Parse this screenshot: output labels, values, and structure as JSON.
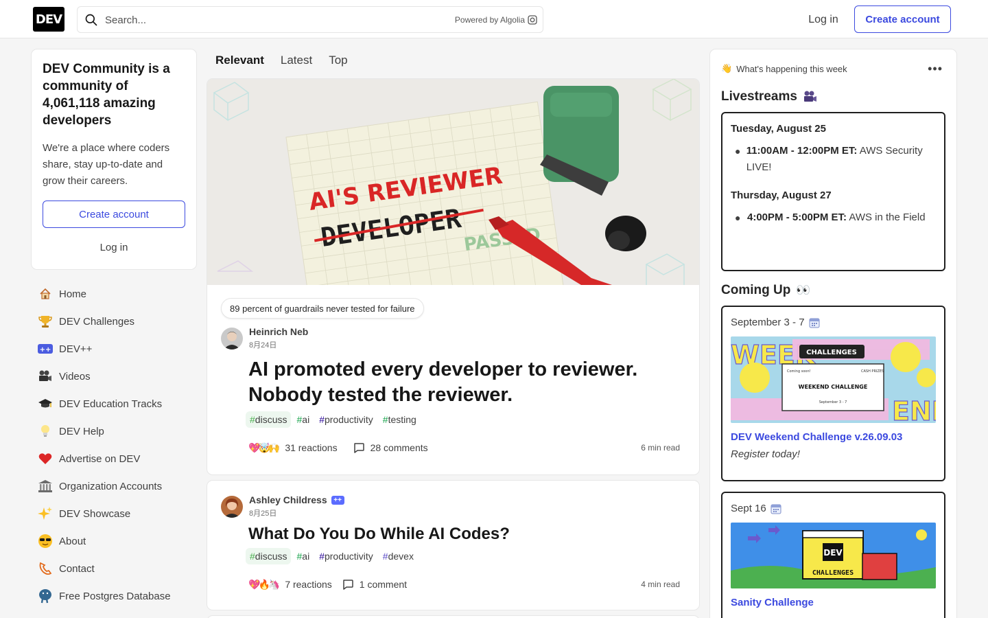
{
  "header": {
    "logo": "DEV",
    "search_placeholder": "Search...",
    "powered_by": "Powered by Algolia",
    "login": "Log in",
    "create_account": "Create account"
  },
  "intro": {
    "title": "DEV Community is a community of 4,061,118 amazing developers",
    "body": "We're a place where coders share, stay up-to-date and grow their careers.",
    "create_account": "Create account",
    "login": "Log in"
  },
  "nav": {
    "items": [
      {
        "label": "Home",
        "icon": "house-icon"
      },
      {
        "label": "DEV Challenges",
        "icon": "trophy-icon"
      },
      {
        "label": "DEV++",
        "icon": "devplusplus-icon"
      },
      {
        "label": "Videos",
        "icon": "video-camera-icon"
      },
      {
        "label": "DEV Education Tracks",
        "icon": "graduation-cap-icon"
      },
      {
        "label": "DEV Help",
        "icon": "lightbulb-icon"
      },
      {
        "label": "Advertise on DEV",
        "icon": "heart-icon"
      },
      {
        "label": "Organization Accounts",
        "icon": "classical-building-icon"
      },
      {
        "label": "DEV Showcase",
        "icon": "sparkles-icon"
      },
      {
        "label": "About",
        "icon": "sunglasses-icon"
      },
      {
        "label": "Contact",
        "icon": "contact-icon"
      },
      {
        "label": "Free Postgres Database",
        "icon": "postgres-elephant-icon"
      }
    ]
  },
  "feed": {
    "tabs": [
      "Relevant",
      "Latest",
      "Top"
    ],
    "posts": [
      {
        "cover_text": {
          "line1": "AI'S REVIEWER",
          "line2": "DEVELOPER",
          "stamp": "PASSED"
        },
        "tagline": "89 percent of guardrails never tested for failure",
        "author": "Heinrich Neb",
        "date": "8月24日",
        "title_line1": "AI promoted every developer to reviewer.",
        "title_line2": "Nobody tested the reviewer.",
        "tags": [
          "discuss",
          "ai",
          "productivity",
          "testing"
        ],
        "reactions": "31 reactions",
        "comments": "28 comments",
        "read_time": "6 min read"
      },
      {
        "author": "Ashley Childress",
        "author_badge": "++",
        "date": "8月25日",
        "title": "What Do You Do While AI Codes?",
        "tags": [
          "discuss",
          "ai",
          "productivity",
          "devex"
        ],
        "reactions": "7 reactions",
        "comments": "1 comment",
        "read_time": "4 min read"
      }
    ]
  },
  "sidebar_right": {
    "week_label": "What's happening this week",
    "livestreams": {
      "heading": "Livestreams",
      "days": [
        {
          "day": "Tuesday, August 25",
          "time": "11:00AM - 12:00PM ET:",
          "title": "AWS Security LIVE!"
        },
        {
          "day": "Thursday, August 27",
          "time": "4:00PM - 5:00PM ET:",
          "title": "AWS in the Field"
        }
      ]
    },
    "coming_up": {
      "heading": "Coming Up",
      "events": [
        {
          "date": "September 3 - 7",
          "title": "DEV Weekend Challenge v.26.09.03",
          "subtitle": "Register today!",
          "image_text": {
            "challenges": "CHALLENGES",
            "coming_soon": "Coming soon!",
            "cash": "CASH PRIZES",
            "name": "WEEKEND CHALLENGE",
            "dates": "September 3 - 7",
            "end": "END",
            "week": "WEEK"
          }
        },
        {
          "date": "Sept 16",
          "title": "Sanity Challenge",
          "image_text": {
            "logo": "DEV",
            "challenges": "CHALLENGES"
          }
        }
      ]
    }
  }
}
